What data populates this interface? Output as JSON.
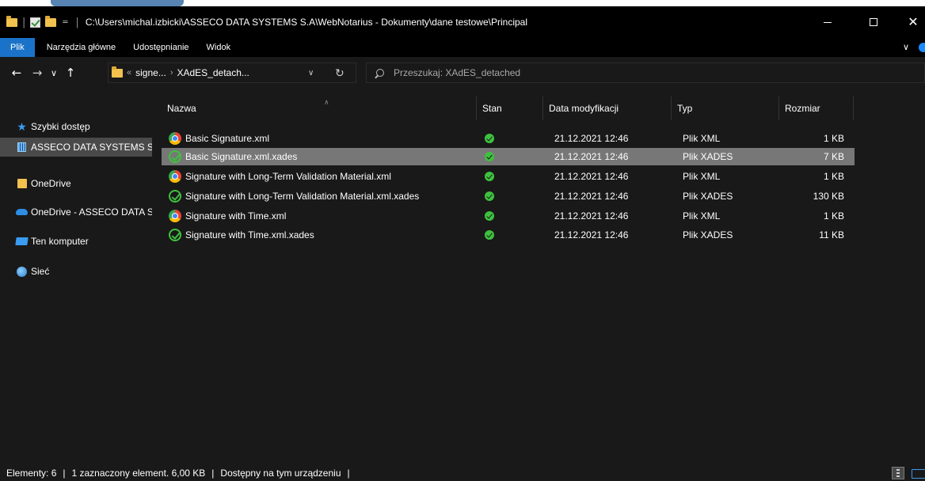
{
  "window": {
    "path": "C:\\Users\\michal.izbicki\\ASSECO DATA SYSTEMS S.A\\WebNotarius - Dokumenty\\dane testowe\\Principal"
  },
  "ribbon": {
    "tabs": [
      "Plik",
      "Narzędzia główne",
      "Udostępnianie",
      "Widok"
    ]
  },
  "navigation": {
    "breadcrumbs": [
      "signe...",
      "XAdES_detach..."
    ],
    "overflow": "«",
    "search_placeholder": "Przeszukaj: XAdES_detached"
  },
  "sidebar": {
    "items": [
      {
        "label": "Szybki dostęp",
        "icon": "star-icon"
      },
      {
        "label": "ASSECO DATA SYSTEMS S.A",
        "icon": "building-icon",
        "selected": true
      },
      {
        "label": "OneDrive",
        "icon": "onedrive-folder-icon"
      },
      {
        "label": "OneDrive - ASSECO DATA SYSTEMS S.A",
        "icon": "onedrive-cloud-icon"
      },
      {
        "label": "Ten komputer",
        "icon": "computer-icon"
      },
      {
        "label": "Sieć",
        "icon": "network-icon"
      }
    ]
  },
  "columns": {
    "name": "Nazwa",
    "status": "Stan",
    "modified": "Data modyfikacji",
    "type": "Typ",
    "size": "Rozmiar"
  },
  "files": [
    {
      "name": "Basic Signature.xml",
      "date": "21.12.2021 12:46",
      "type": "Plik XML",
      "size": "1 KB",
      "icon": "chrome-icon",
      "selected": false
    },
    {
      "name": "Basic Signature.xml.xades",
      "date": "21.12.2021 12:46",
      "type": "Plik XADES",
      "size": "7 KB",
      "icon": "xades-icon",
      "selected": true
    },
    {
      "name": "Signature with Long-Term Validation Material.xml",
      "date": "21.12.2021 12:46",
      "type": "Plik XML",
      "size": "1 KB",
      "icon": "chrome-icon",
      "selected": false
    },
    {
      "name": "Signature with Long-Term Validation Material.xml.xades",
      "date": "21.12.2021 12:46",
      "type": "Plik XADES",
      "size": "130 KB",
      "icon": "xades-icon",
      "selected": false
    },
    {
      "name": "Signature with Time.xml",
      "date": "21.12.2021 12:46",
      "type": "Plik XML",
      "size": "1 KB",
      "icon": "chrome-icon",
      "selected": false
    },
    {
      "name": "Signature with Time.xml.xades",
      "date": "21.12.2021 12:46",
      "type": "Plik XADES",
      "size": "11 KB",
      "icon": "xades-icon",
      "selected": false
    }
  ],
  "statusbar": {
    "count": "Elementy: 6",
    "selection": "1 zaznaczony element. 6,00 KB",
    "availability": "Dostępny na tym urządzeniu"
  },
  "colors": {
    "file_tab": "#1a73c8",
    "selected_row": "#777777",
    "background": "#191919",
    "status_ok": "#3ec23e"
  }
}
